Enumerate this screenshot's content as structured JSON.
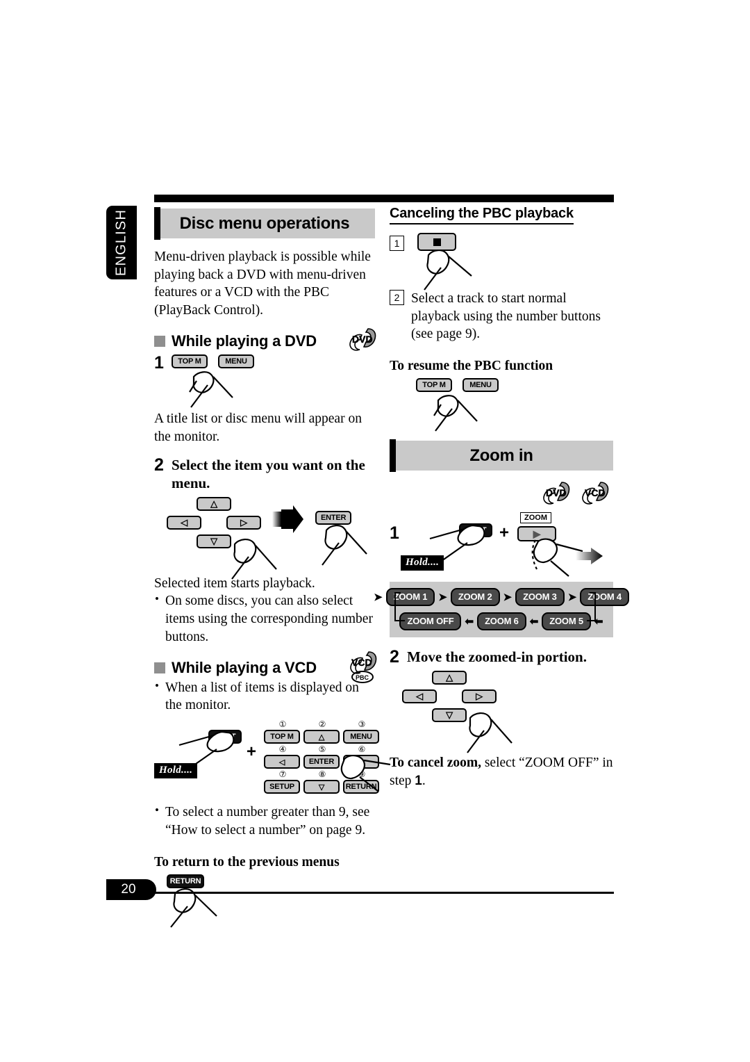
{
  "page": {
    "language_tab": "ENGLISH",
    "page_number": "20"
  },
  "left_column": {
    "section_title": "Disc menu operations",
    "intro": "Menu-driven playback is possible while playing back a DVD with menu-driven features or a VCD with the PBC (PlayBack Control).",
    "dvd_section": {
      "heading": "While playing a DVD",
      "disc_badge": "DVD",
      "step1": {
        "number": "1",
        "keys": [
          "TOP M",
          "MENU"
        ],
        "result_text": "A title list or disc menu will appear on the monitor."
      },
      "step2": {
        "number": "2",
        "title": "Select the item you want on the menu.",
        "dpad": {
          "up": "△",
          "left": "◁",
          "right": "▷",
          "down": "▽"
        },
        "enter_key": "ENTER",
        "result_text": "Selected item starts playback.",
        "bullets": [
          "On some discs, you can also select items using the corresponding number buttons."
        ]
      }
    },
    "vcd_section": {
      "heading": "While playing a VCD",
      "disc_badge": "VCD",
      "disc_badge_sub": "PBC",
      "bullets_top": [
        "When a list of items is displayed on the monitor."
      ],
      "hold_label": "Hold....",
      "shift_key": "SHIFT",
      "plus": "+",
      "keypad": [
        {
          "num": "①",
          "label": "TOP M"
        },
        {
          "num": "②",
          "label": "△"
        },
        {
          "num": "③",
          "label": "MENU"
        },
        {
          "num": "④",
          "label": "◁"
        },
        {
          "num": "⑤",
          "label": "ENTER"
        },
        {
          "num": "⑥",
          "label": "▷"
        },
        {
          "num": "⑦",
          "label": "SETUP"
        },
        {
          "num": "⑧",
          "label": "▽"
        },
        {
          "num": "⑨",
          "label": "RETURN"
        }
      ],
      "bullets_bottom": [
        "To select a number greater than 9, see “How to select a number” on page 9."
      ],
      "return_heading": "To return to the previous menus",
      "return_key": "RETURN"
    }
  },
  "right_column": {
    "pbc_section": {
      "heading": "Canceling the PBC playback",
      "step1": {
        "number": "1",
        "key_icon": "stop-button"
      },
      "step2": {
        "number": "2",
        "text": "Select a track to start normal playback using the number buttons (see page 9)."
      },
      "resume_heading": "To resume the PBC function",
      "resume_keys": [
        "TOP M",
        "MENU"
      ]
    },
    "zoom_section": {
      "section_title": "Zoom in",
      "disc_badges": [
        "DVD",
        "VCD"
      ],
      "step1": {
        "number": "1",
        "hold_label": "Hold....",
        "shift_key": "SHIFT",
        "plus": "+",
        "zoom_label": "ZOOM",
        "zoom_key_glyph": "▶"
      },
      "cycle": {
        "row1": [
          "ZOOM 1",
          "ZOOM 2",
          "ZOOM 3",
          "ZOOM 4"
        ],
        "row2": [
          "ZOOM OFF",
          "ZOOM 6",
          "ZOOM 5"
        ],
        "arrow_right": "➤",
        "arrow_left": "⬅"
      },
      "step2": {
        "number": "2",
        "title": "Move the zoomed-in portion.",
        "dpad": {
          "up": "△",
          "left": "◁",
          "right": "▷",
          "down": "▽"
        }
      },
      "cancel_text_bold": "To cancel zoom,",
      "cancel_text_rest": " select “ZOOM OFF” in step ",
      "cancel_step_num": "1",
      "cancel_text_end": "."
    }
  },
  "colors": {
    "banner_grey": "#c9c9c9",
    "key_grey": "#c9c9c9",
    "chip_dark": "#4a4a4a",
    "black": "#000000"
  }
}
